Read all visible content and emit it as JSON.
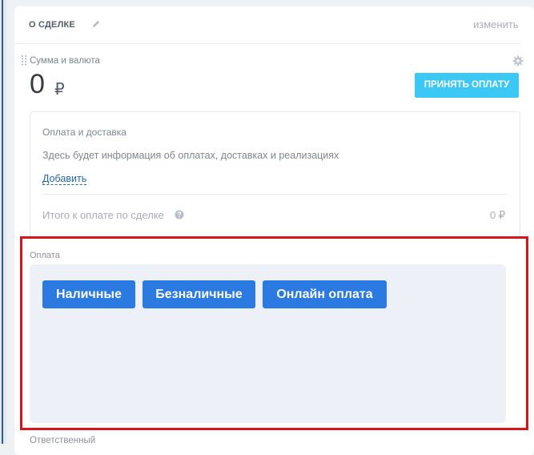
{
  "card": {
    "title": "О СДЕЛКЕ",
    "edit_link": "изменить"
  },
  "amount_field": {
    "label": "Сумма и валюта",
    "value": "0",
    "currency": "₽",
    "accept_button": "ПРИНЯТЬ ОПЛАТУ"
  },
  "payment_delivery": {
    "title": "Оплата и доставка",
    "info": "Здесь будет информация об оплатах, доставках и реализациях",
    "add_link": "Добавить",
    "total_label": "Итого к оплате по сделке",
    "total_value": "0 ₽"
  },
  "payment": {
    "label": "Оплата",
    "buttons": [
      "Наличные",
      "Безналичные",
      "Онлайн оплата"
    ]
  },
  "responsible": {
    "label": "Ответственный"
  },
  "colors": {
    "accept_button": "#3bc8f5",
    "payment_button": "#2a7ae2",
    "highlight_border": "#d4151c",
    "link": "#2067b0"
  },
  "icons": {
    "edit": "pencil-icon",
    "settings": "gear-icon",
    "drag": "drag-handle-icon",
    "help": "question-circle-icon"
  }
}
